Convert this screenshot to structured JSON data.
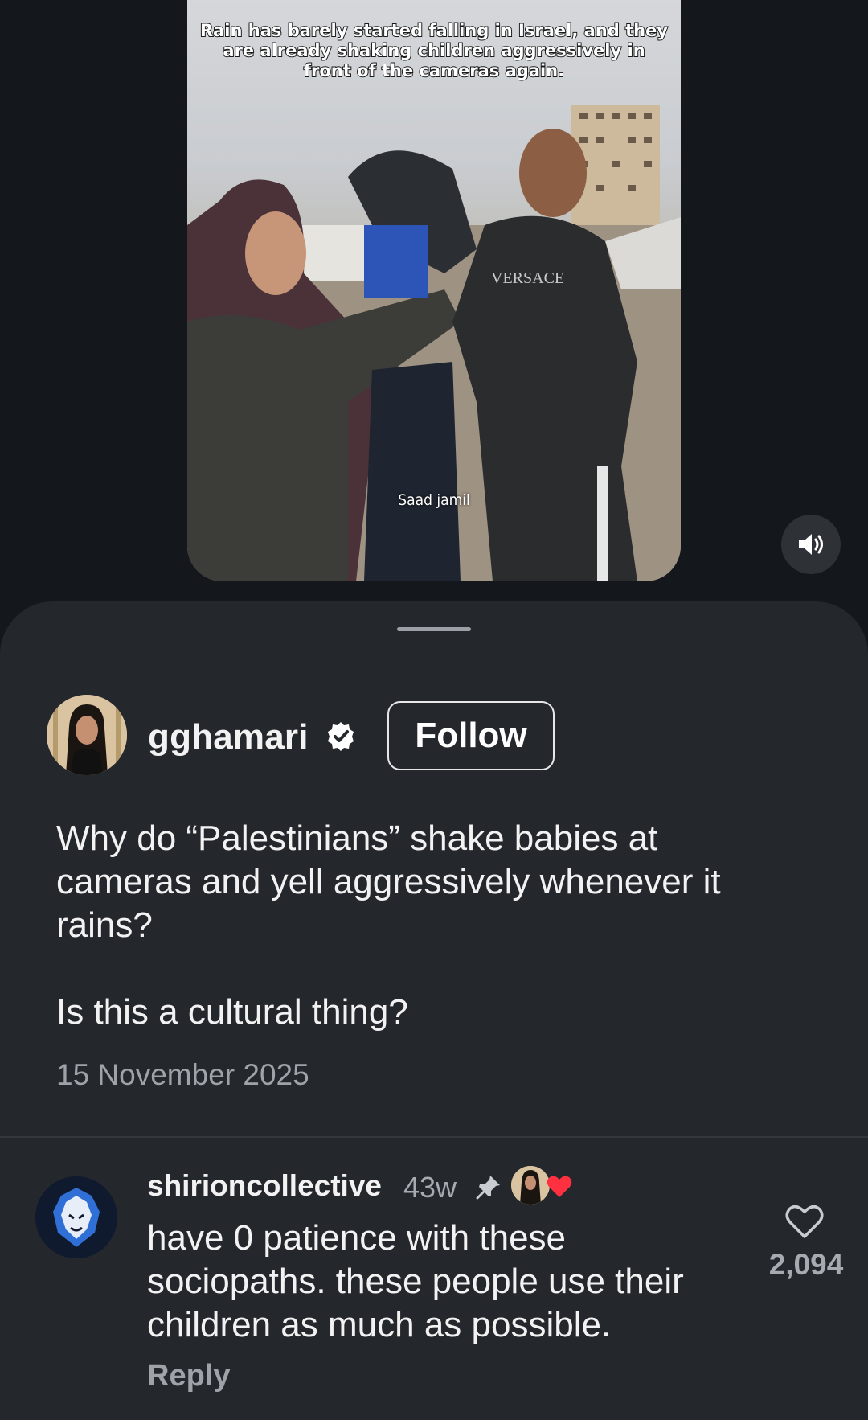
{
  "video": {
    "caption_overlay": "Rain has barely started falling in Israel, and they are already shaking children aggressively in front of the cameras again.",
    "watermark": "Saad jamil",
    "sweater_text": "VERSACE",
    "speaker_icon": "speaker-on-icon"
  },
  "post": {
    "username": "gghamari",
    "verified_icon": "verified-badge-icon",
    "follow_label": "Follow",
    "body": "Why do “Palestinians” shake babies at cameras and yell aggressively whenever it rains?\n\nIs this a cultural thing?",
    "date": "15 November 2025"
  },
  "comment": {
    "username": "shirioncollective",
    "time": "43w",
    "pin_icon": "pin-icon",
    "text": "have 0 patience with these sociopaths. these people use their children as much as possible.",
    "reply_label": "Reply",
    "like_icon": "heart-outline-icon",
    "like_count": "2,094",
    "liked_by_author_icon": "red-heart-icon"
  },
  "colors": {
    "background": "#14171b",
    "sheet": "#24272c",
    "muted_text": "#9ea3a9",
    "heart_red": "#ff3040"
  }
}
